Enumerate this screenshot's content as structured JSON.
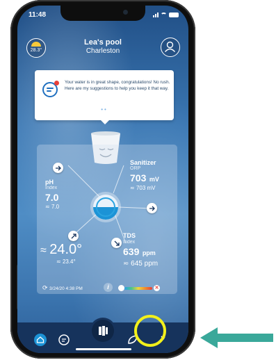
{
  "status_bar": {
    "time": "11:48"
  },
  "header": {
    "weather_temp": "28.3°",
    "pool_name": "Lea's pool",
    "location": "Charleston"
  },
  "message": {
    "text": "Your water is in great shape, congratulations! No rush. Here are my suggestions to help you keep it that way.",
    "page_dots": "••"
  },
  "stats": {
    "ph": {
      "label": "pH",
      "sublabel": "Index",
      "value": "7.0",
      "target": "7.0"
    },
    "sanitizer": {
      "label": "Sanitizer",
      "sublabel": "ORP",
      "value": "703",
      "unit": "mV",
      "target": "703 mV"
    },
    "tds": {
      "label": "TDS",
      "sublabel": "Index",
      "value": "639",
      "unit": "ppm",
      "target": "645 ppm"
    },
    "temperature": {
      "prefix": "≈",
      "value": "24.0°",
      "target": "23.4°"
    },
    "timestamp": "3/24/20 4:38 PM",
    "info_label": "i"
  },
  "colors": {
    "accent": "#1c93d6",
    "tab_bar": "#16335c",
    "highlight": "#f2f01b",
    "pointer_arrow": "#3aa89a"
  },
  "icons": {
    "tab_home": "home-icon",
    "tab_chat": "chat-icon",
    "tab_center": "pool-panel-icon",
    "tab_refresh": "leaf-icon",
    "tab_edit": "eyedropper-icon"
  }
}
